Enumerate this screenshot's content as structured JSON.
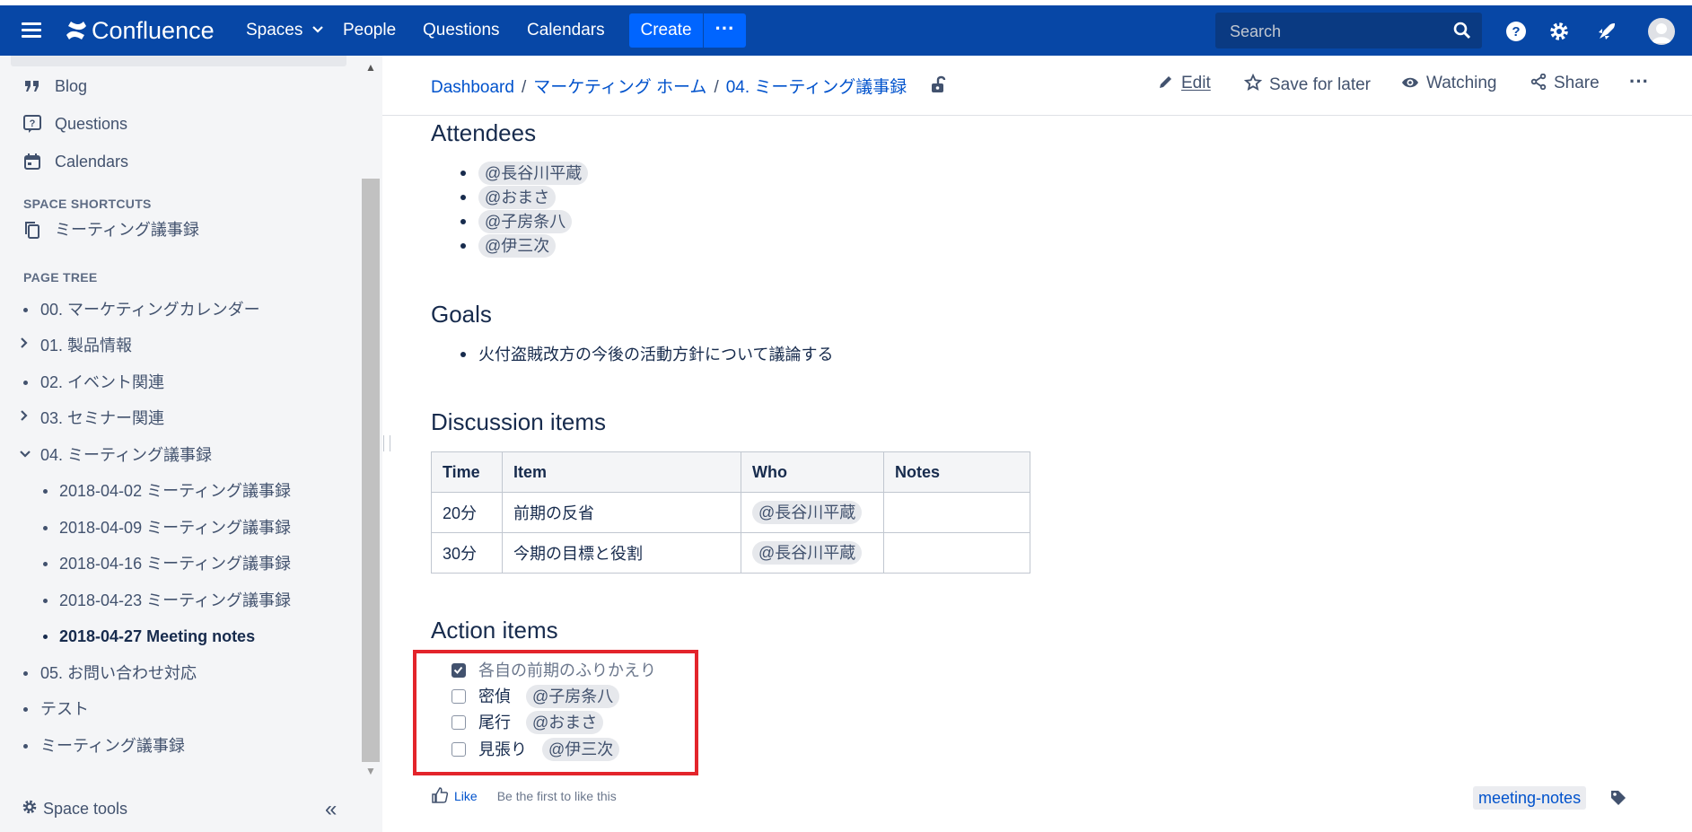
{
  "topnav": {
    "logo_text": "Confluence",
    "spaces_label": "Spaces",
    "people_label": "People",
    "questions_label": "Questions",
    "calendars_label": "Calendars",
    "create_label": "Create",
    "more_label": "···",
    "search_placeholder": "Search",
    "icons": [
      "menu-icon",
      "confluence-logo-icon",
      "chevron-down-icon",
      "search-icon",
      "help-icon",
      "gear-icon",
      "notifications-icon",
      "user-avatar"
    ],
    "bar_color": "#0747A6",
    "create_color": "#0065FF"
  },
  "sidebar": {
    "nav": [
      {
        "label": "Blog",
        "icon": "quote-icon"
      },
      {
        "label": "Questions",
        "icon": "question-icon"
      },
      {
        "label": "Calendars",
        "icon": "calendar-icon"
      }
    ],
    "shortcuts_heading": "SPACE SHORTCUTS",
    "shortcut": {
      "label": "ミーティング議事録",
      "icon": "copy-icon"
    },
    "page_tree_heading": "PAGE TREE",
    "tree": [
      {
        "label": "00. マーケティングカレンダー",
        "marker": "bullet"
      },
      {
        "label": "01. 製品情報",
        "marker": "chevron-right"
      },
      {
        "label": "02. イベント関連",
        "marker": "bullet"
      },
      {
        "label": "03. セミナー関連",
        "marker": "chevron-right"
      },
      {
        "label": "04. ミーティング議事録",
        "marker": "chevron-down"
      },
      {
        "label": "2018-04-02 ミーティング議事録",
        "marker": "bullet"
      },
      {
        "label": "2018-04-09 ミーティング議事録",
        "marker": "bullet"
      },
      {
        "label": "2018-04-16 ミーティング議事録",
        "marker": "bullet"
      },
      {
        "label": "2018-04-23 ミーティング議事録",
        "marker": "bullet"
      },
      {
        "label": "2018-04-27 Meeting notes",
        "marker": "bullet",
        "current": true
      },
      {
        "label": "05. お問い合わせ対応",
        "marker": "bullet"
      },
      {
        "label": "テスト",
        "marker": "bullet"
      },
      {
        "label": "ミーティング議事録",
        "marker": "bullet"
      }
    ],
    "space_tools_label": "Space tools",
    "collapse_label": "«"
  },
  "breadcrumbs": [
    "Dashboard",
    "マーケティング ホーム",
    "04. ミーティング議事録"
  ],
  "breadcrumb_sep": "/",
  "actions": {
    "edit": "Edit",
    "save_for_later": "Save for later",
    "watching": "Watching",
    "share": "Share",
    "more": "···"
  },
  "content": {
    "attendees_heading": "Attendees",
    "attendees": [
      "@長谷川平蔵",
      "@おまさ",
      "@子房条八",
      "@伊三次"
    ],
    "goals_heading": "Goals",
    "goals": [
      "火付盗賊改方の今後の活動方針について議論する"
    ],
    "discussion_heading": "Discussion items",
    "discussion_table": {
      "headers": [
        "Time",
        "Item",
        "Who",
        "Notes"
      ],
      "rows": [
        [
          "20分",
          "前期の反省",
          "@長谷川平蔵",
          ""
        ],
        [
          "30分",
          "今期の目標と役割",
          "@長谷川平蔵",
          ""
        ]
      ]
    },
    "action_heading": "Action items",
    "tasks": [
      {
        "text": "各自の前期のふりかえり",
        "mention": "",
        "checked": true
      },
      {
        "text": "密偵",
        "mention": "@子房条八",
        "checked": false
      },
      {
        "text": "尾行",
        "mention": "@おまさ",
        "checked": false
      },
      {
        "text": "見張り",
        "mention": "@伊三次",
        "checked": false
      }
    ],
    "highlight_color": "#E3242B"
  },
  "footer": {
    "like_label": "Like",
    "first_like": "Be the first to like this",
    "label_tag": "meeting-notes"
  }
}
